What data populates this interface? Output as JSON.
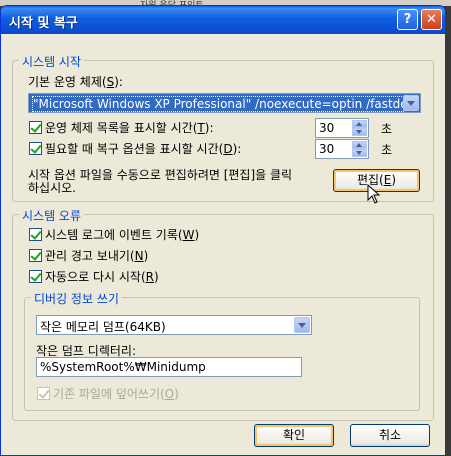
{
  "window": {
    "title": "시작 및 복구"
  },
  "startup": {
    "legend": "시스템 시작",
    "default_os_label": "기본 운영 체제(",
    "default_os_key": "S",
    "default_os_suffix": "):",
    "default_os_value": "\"Microsoft Windows XP Professional\" /noexecute=optin /fastdete",
    "os_list_label": "운영 체제 목록을 표시할 시간(",
    "os_list_key": "T",
    "os_list_suffix": "):",
    "os_list_checked": true,
    "os_list_seconds": "30",
    "recovery_label": "필요할 때 복구 옵션을 표시할 시간(",
    "recovery_key": "D",
    "recovery_suffix": "):",
    "recovery_checked": true,
    "recovery_seconds": "30",
    "seconds_unit": "초",
    "edit_hint_line1": "시작 옵션 파일을 수동으로 편집하려면 [편집]을 클릭",
    "edit_hint_line2": "하십시오.",
    "edit_button": "편집(",
    "edit_key": "E",
    "edit_suffix": ")"
  },
  "failure": {
    "legend": "시스템 오류",
    "write_event_label": "시스템 로그에 이벤트 기록(",
    "write_event_key": "W",
    "write_event_suffix": ")",
    "write_event_checked": true,
    "send_alert_label": "관리 경고 보내기(",
    "send_alert_key": "N",
    "send_alert_suffix": ")",
    "send_alert_checked": true,
    "auto_restart_label": "자동으로 다시 시작(",
    "auto_restart_key": "R",
    "auto_restart_suffix": ")",
    "auto_restart_checked": true
  },
  "debug": {
    "legend": "디버깅 정보 쓰기",
    "type_value": "작은 메모리 덤프(64KB)",
    "dir_label": "작은 덤프 디렉터리:",
    "dir_value": "%SystemRoot%₩Minidump",
    "overwrite_label": "기존 파일에 덮어쓰기(",
    "overwrite_key": "O",
    "overwrite_suffix": ")",
    "overwrite_checked": true,
    "overwrite_enabled": false
  },
  "buttons": {
    "ok": "확인",
    "cancel": "취소"
  },
  "background": {
    "strip_text": "자원 응답   포인트"
  },
  "colors": {
    "titlebar": "#0a5ee6",
    "legend": "#0046d5",
    "face": "#ece9d8",
    "check": "#21a121"
  }
}
